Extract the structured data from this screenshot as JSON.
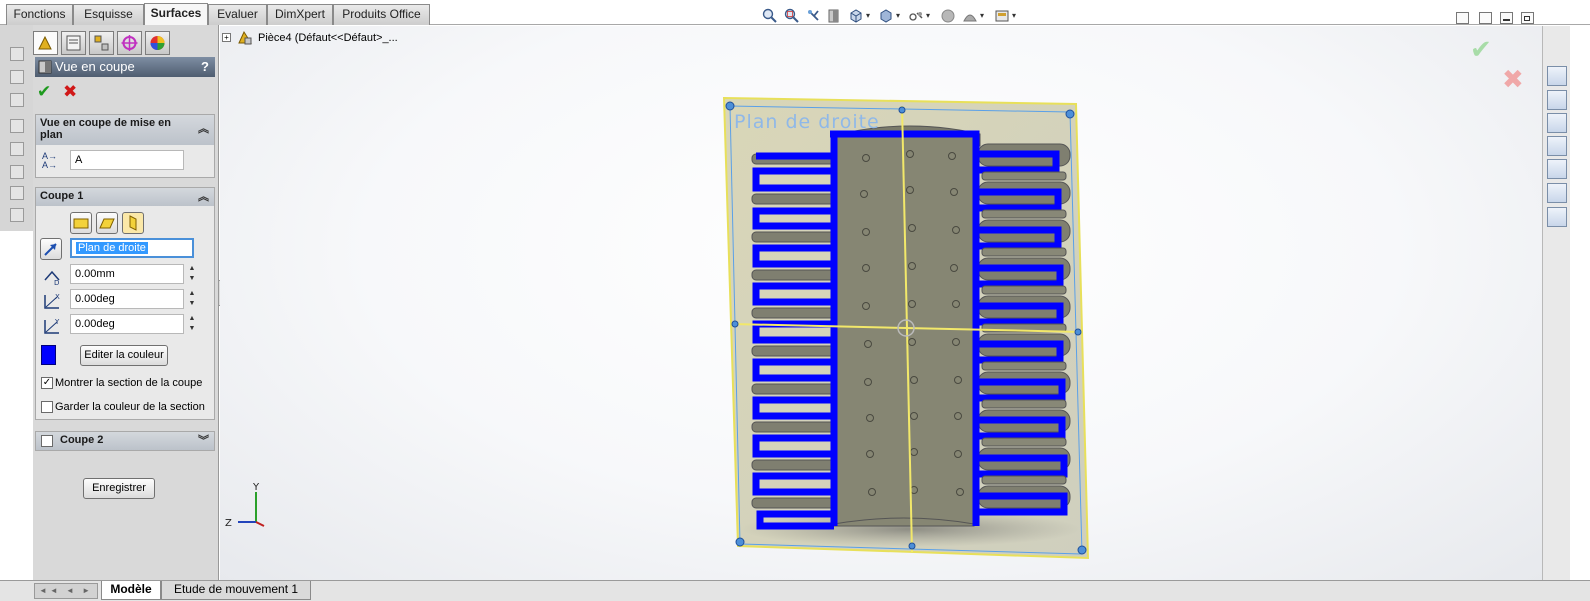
{
  "command_tabs": [
    {
      "label": "Fonctions",
      "active": false
    },
    {
      "label": "Esquisse",
      "active": false
    },
    {
      "label": "Surfaces",
      "active": true
    },
    {
      "label": "Evaluer",
      "active": false
    },
    {
      "label": "DimXpert",
      "active": false
    },
    {
      "label": "Produits Office",
      "active": false
    }
  ],
  "property_manager": {
    "title": "Vue en coupe",
    "help": "?",
    "ok": "✔",
    "cancel": "✖",
    "group_plan": {
      "header": "Vue en coupe de mise en plan",
      "chevron": "︽",
      "icon_text": "A→\nA→",
      "name_value": "A"
    },
    "group_coupe1": {
      "header": "Coupe 1",
      "chevron": "︽",
      "reference_plane": "Plan de droite",
      "offset": "0.00mm",
      "rotation_x": "0.00deg",
      "rotation_y": "0.00deg",
      "edit_color_button": "Editer la couleur",
      "section_color": "#0000ff",
      "show_section_label": "Montrer la section de la coupe",
      "show_section_checked": true,
      "keep_color_label": "Garder la couleur de la section",
      "keep_color_checked": false,
      "spin_up": "▲",
      "spin_down": "▼"
    },
    "group_coupe2": {
      "header": "Coupe 2",
      "chevron": "︾",
      "checked": false
    },
    "save_button": "Enregistrer"
  },
  "tree": {
    "expand": "+",
    "part_label": "Pièce4  (Défaut<<Défaut>_..."
  },
  "viewport": {
    "plane_label": "Plan de droite",
    "triad": {
      "y": "Y",
      "z": "Z"
    },
    "confirm_ok": "✔",
    "confirm_cancel": "✖"
  },
  "bottom_tabs": [
    {
      "label": "Modèle",
      "active": true
    },
    {
      "label": "Etude de mouvement 1",
      "active": false
    }
  ],
  "bottom_nav": "◄◄ ◄ ► ►►",
  "colors": {
    "section_blue": "#0000ff",
    "plane_yellow": "#e8e05a",
    "plane_label": "#8fb8e8",
    "model_gray": "#858570"
  }
}
